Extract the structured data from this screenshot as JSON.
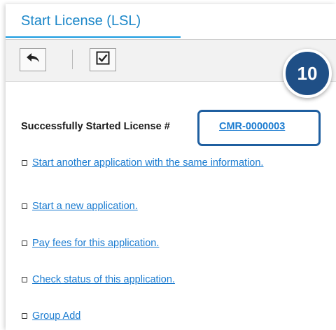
{
  "tab": {
    "label": "Start License (LSL)"
  },
  "toolbar": {
    "buttons": [
      {
        "name": "back",
        "icon": "undo-arrow-icon"
      },
      {
        "name": "confirm",
        "icon": "checkbox-checked-icon"
      }
    ]
  },
  "badge": {
    "number": "10",
    "color": "#1f4f86"
  },
  "result": {
    "message": "Successfully Started License #",
    "license_number": "CMR-0000003"
  },
  "actions": [
    {
      "label": "Start another application with the same information."
    },
    {
      "label": "Start a new application."
    },
    {
      "label": "Pay fees for this application."
    },
    {
      "label": "Check status of this application."
    },
    {
      "label": "Group Add"
    }
  ],
  "colors": {
    "link": "#1a7bd0",
    "tab_accent": "#1a9be0",
    "highlight": "#1f5fa0"
  }
}
